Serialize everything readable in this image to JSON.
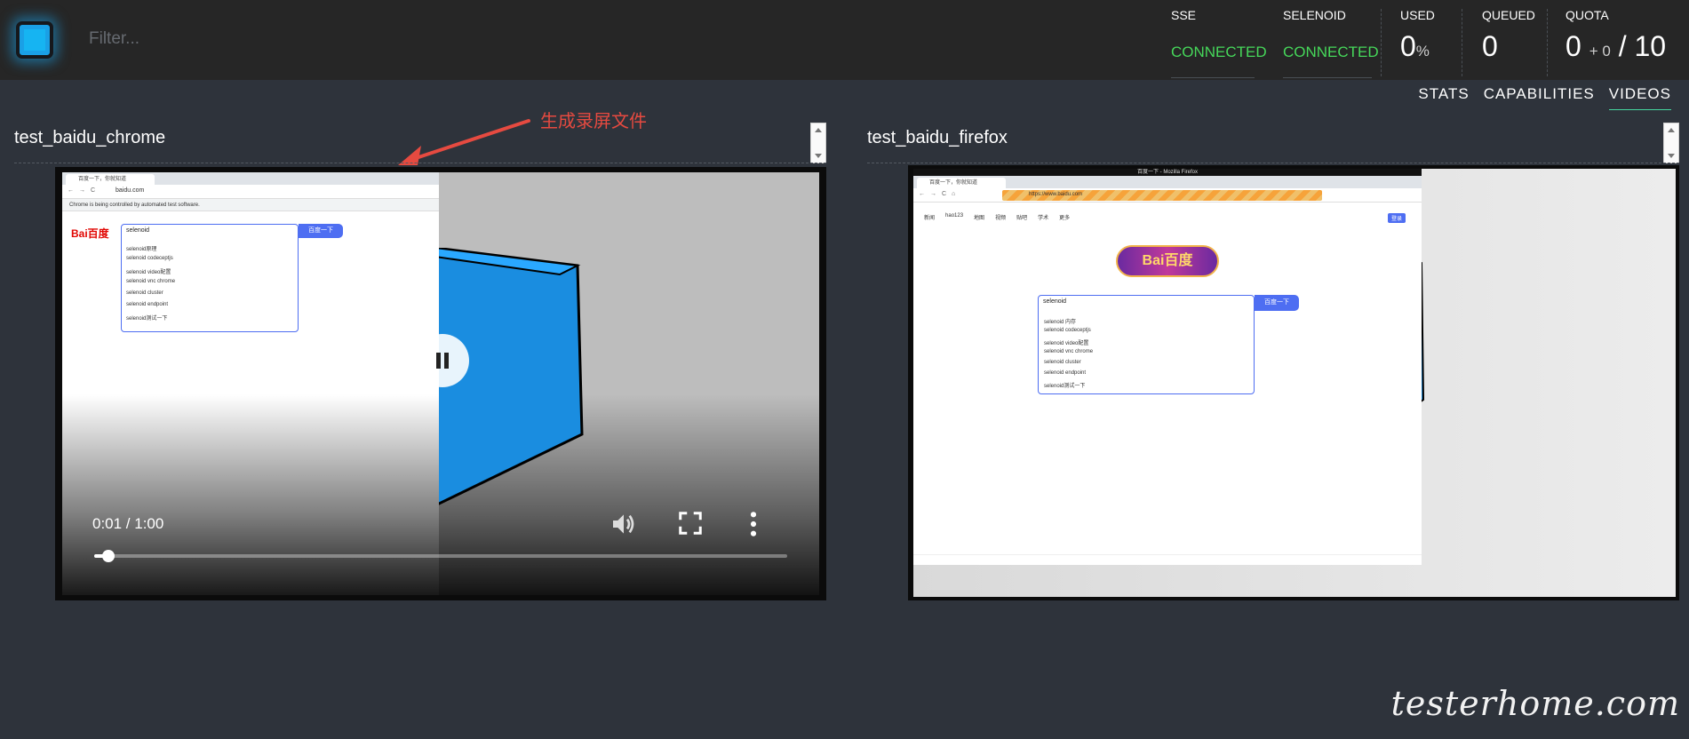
{
  "header": {
    "filter_placeholder": "Filter...",
    "stats": {
      "sse": {
        "label": "SSE",
        "status": "CONNECTED"
      },
      "selenoid": {
        "label": "SELENOID",
        "status": "CONNECTED"
      },
      "used": {
        "label": "USED",
        "value": "0",
        "unit": "%"
      },
      "queued": {
        "label": "QUEUED",
        "value": "0"
      },
      "quota": {
        "label": "QUOTA",
        "used": "0",
        "plus": "+ 0",
        "sep": "/",
        "total": "10"
      }
    }
  },
  "tabs": [
    {
      "label": "STATS",
      "active": false
    },
    {
      "label": "CAPABILITIES",
      "active": false
    },
    {
      "label": "VIDEOS",
      "active": true
    }
  ],
  "annotation": "生成录屏文件",
  "videos": [
    {
      "title": "test_baidu_chrome",
      "player": {
        "time": "0:01 / 1:00",
        "progress": 0.02,
        "state": "playing",
        "icons": [
          "pause-icon",
          "volume-icon",
          "fullscreen-icon",
          "more-icon"
        ]
      },
      "browser": {
        "tab": "百度一下，你就知道",
        "url": "baidu.com",
        "infobar": "Chrome is being controlled by automated test software.",
        "logo": "Bai百度",
        "search_text": "selenoid",
        "search_button": "百度一下",
        "suggestions": [
          "selenoid原理",
          "selenoid codeceptjs",
          "selenoid video配置",
          "selenoid vnc chrome",
          "selenoid cluster",
          "selenoid endpoint",
          "selenoid测试一下"
        ]
      }
    },
    {
      "title": "test_baidu_firefox",
      "browser": {
        "window_title": "百度一下 - Mozilla Firefox",
        "tab": "百度一下，你就知道",
        "url": "https://www.baidu.com",
        "nav_links": [
          "新闻",
          "hao123",
          "地图",
          "视频",
          "贴吧",
          "学术",
          "更多"
        ],
        "login_label": "登录",
        "logo": "Bai百度",
        "search_text": "selenoid",
        "search_button": "百度一下",
        "suggestions": [
          "selenoid 内存",
          "selenoid codeceptjs",
          "selenoid video配置",
          "selenoid vnc chrome",
          "selenoid cluster",
          "selenoid endpoint",
          "selenoid测试一下"
        ]
      }
    }
  ],
  "watermark": "testerhome.com",
  "colors": {
    "connected": "#46d85a",
    "accent": "#16b4f2",
    "annotation": "#e64a40"
  }
}
